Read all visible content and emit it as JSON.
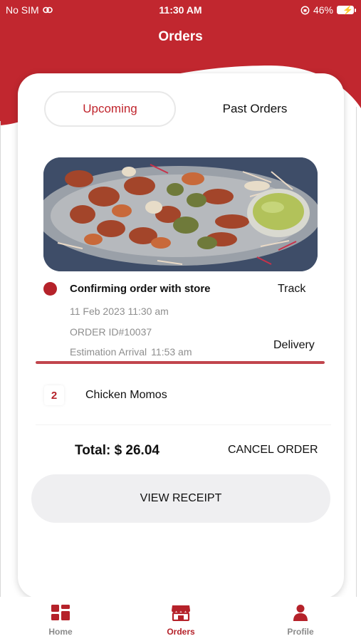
{
  "status_bar": {
    "carrier": "No SIM",
    "time": "11:30 AM",
    "battery": "46%",
    "wifi_icon": "wifi-icon",
    "lock_icon": "orientation-lock-icon",
    "battery_icon": "battery-charging-icon"
  },
  "header": {
    "title": "Orders",
    "color": "#c1272f"
  },
  "segments": {
    "upcoming": "Upcoming",
    "past": "Past Orders",
    "active": "upcoming"
  },
  "order": {
    "status": "Confirming order with store",
    "track_label": "Track",
    "date": "11 Feb 2023 11:30 am",
    "order_id": "ORDER ID#10037",
    "eta_label": "Estimation Arrival",
    "eta_time": "11:53 am",
    "delivery_label": "Delivery",
    "progress": 1.0,
    "image": "food-platter-image"
  },
  "items": [
    {
      "qty": "2",
      "name": "Chicken Momos"
    }
  ],
  "summary": {
    "total": "Total: $ 26.04",
    "cancel_label": "CANCEL ORDER",
    "view_receipt_label": "VIEW RECEIPT"
  },
  "tabbar": {
    "home": "Home",
    "orders": "Orders",
    "profile": "Profile",
    "active": "orders",
    "accent": "#b5222a"
  }
}
